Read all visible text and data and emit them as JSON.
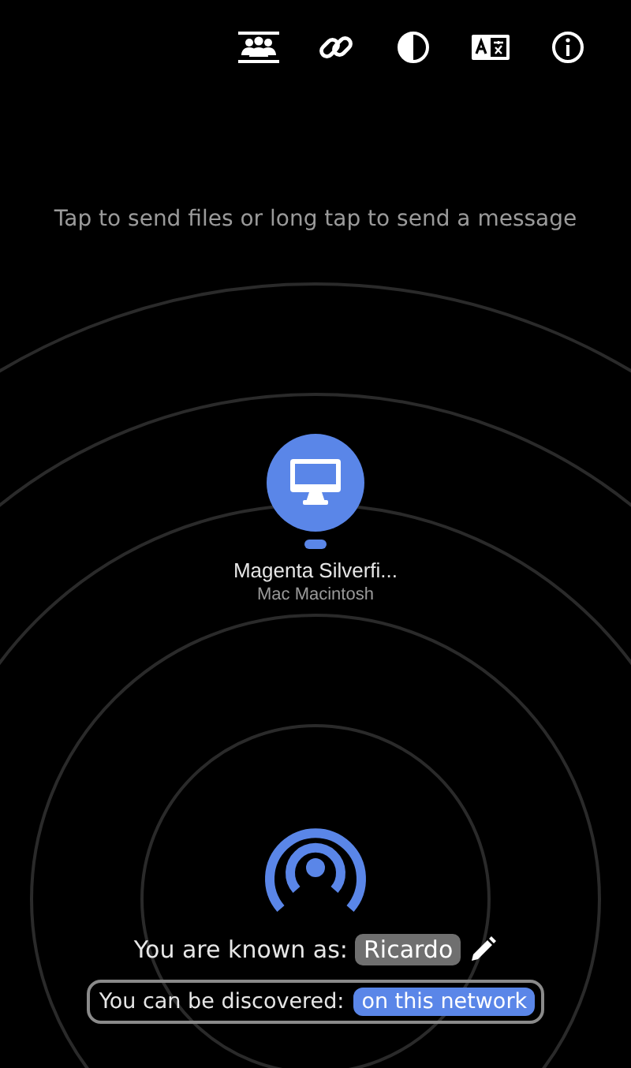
{
  "hint": "Tap to send files or long tap to send a message",
  "peers": [
    {
      "name": "Magenta Silverfi...",
      "device": "Mac Macintosh"
    }
  ],
  "self": {
    "label": "You are known as:",
    "name": "Ricardo"
  },
  "discovery": {
    "label": "You can be discovered:",
    "value": "on this network"
  }
}
